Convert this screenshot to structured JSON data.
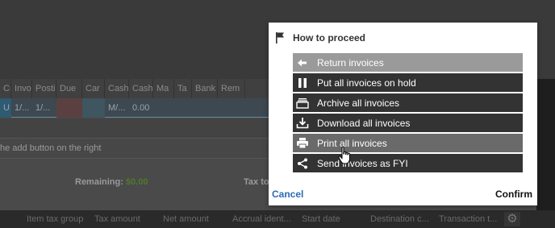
{
  "background": {
    "columns": [
      "Cr",
      "Invo",
      "Posti",
      "Due",
      "Car",
      "Cash",
      "Cash",
      "Ma",
      "Ta",
      "Bank",
      "Rem"
    ],
    "row": [
      "U",
      "1/...",
      "1/...",
      "",
      "",
      "M/...",
      "0.00",
      "",
      "",
      "",
      ""
    ],
    "hint": "he add button on the right",
    "remaining_label": "Remaining:",
    "remaining_value": "$0.00",
    "tax_label": "Tax to",
    "footer_columns": [
      "Item tax group",
      "Tax amount",
      "Net amount",
      "Accrual ident...",
      "Start date",
      "Destination c...",
      "Transaction t..."
    ]
  },
  "dialog": {
    "title": "How to proceed",
    "actions": [
      {
        "label": "Return invoices",
        "icon": "arrow-left-icon",
        "state": "disabled"
      },
      {
        "label": "Put all invoices on hold",
        "icon": "pause-icon",
        "state": "normal"
      },
      {
        "label": "Archive all invoices",
        "icon": "archive-icon",
        "state": "normal"
      },
      {
        "label": "Download all invoices",
        "icon": "download-icon",
        "state": "normal"
      },
      {
        "label": "Print all invoices",
        "icon": "printer-icon",
        "state": "hover"
      },
      {
        "label": "Send invoices as FYI",
        "icon": "share-icon",
        "state": "normal"
      }
    ],
    "cancel_label": "Cancel",
    "confirm_label": "Confirm"
  },
  "colors": {
    "accent_link": "#2a6bb3",
    "action_bg": "#333333",
    "action_hover": "#6a6a6a",
    "action_disabled": "#9a9a9a",
    "positive": "#4f7a2a"
  }
}
